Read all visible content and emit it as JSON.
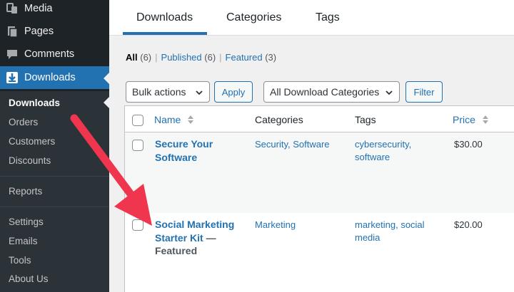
{
  "sidebar": {
    "menu": [
      {
        "label": "Media",
        "icon": "media-icon"
      },
      {
        "label": "Pages",
        "icon": "pages-icon"
      },
      {
        "label": "Comments",
        "icon": "comments-icon"
      },
      {
        "label": "Downloads",
        "icon": "downloads-icon"
      }
    ],
    "submenu": [
      "Downloads",
      "Orders",
      "Customers",
      "Discounts",
      "Reports",
      "Settings",
      "Emails",
      "Tools",
      "About Us"
    ]
  },
  "tabs": [
    "Downloads",
    "Categories",
    "Tags"
  ],
  "filters": {
    "all_label": "All",
    "all_count": "(6)",
    "published_label": "Published",
    "published_count": "(6)",
    "featured_label": "Featured",
    "featured_count": "(3)"
  },
  "toolbar": {
    "bulk_actions": "Bulk actions",
    "apply": "Apply",
    "categories_select": "All Download Categories",
    "filter": "Filter"
  },
  "table": {
    "columns": [
      "Name",
      "Categories",
      "Tags",
      "Price"
    ],
    "rows": [
      {
        "name": "Secure Your Software",
        "state": "",
        "categories": [
          "Security",
          "Software"
        ],
        "tags": [
          "cybersecurity",
          "software"
        ],
        "price": "$30.00"
      },
      {
        "name": "Social Marketing Starter Kit",
        "state": "— Featured",
        "categories": [
          "Marketing"
        ],
        "tags": [
          "marketing",
          "social media"
        ],
        "price": "$20.00"
      }
    ]
  },
  "colors": {
    "accent": "#2271b1",
    "sidebar": "#1d2327",
    "annotation": "#f0354e"
  }
}
